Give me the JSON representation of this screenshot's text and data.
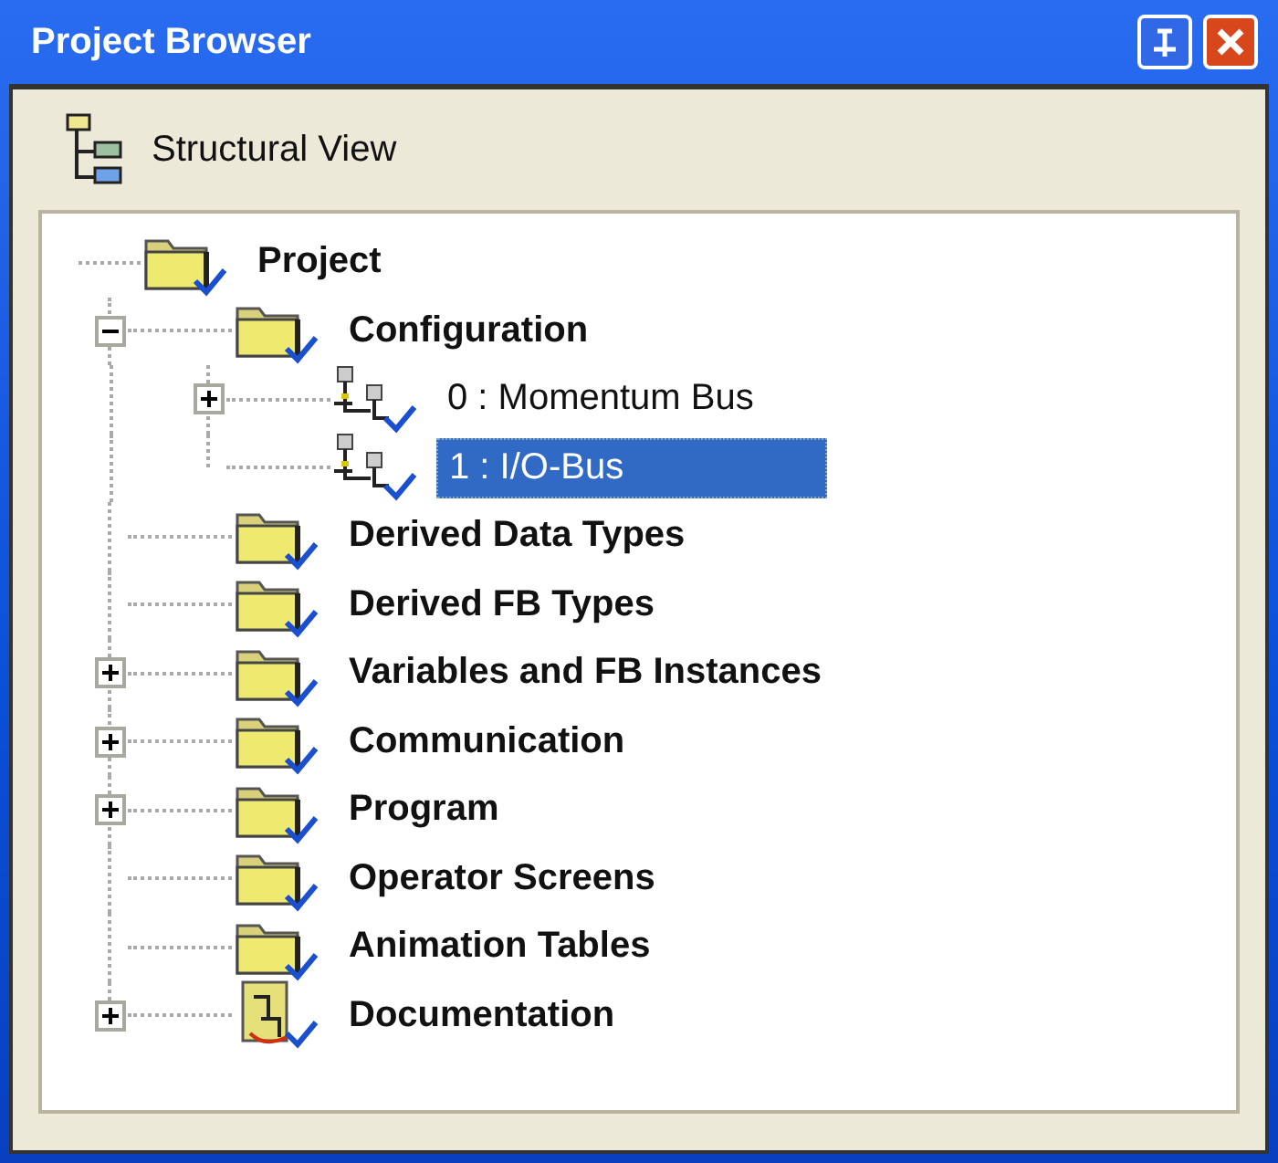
{
  "window": {
    "title": "Project Browser"
  },
  "view": {
    "label": "Structural View"
  },
  "tree": [
    {
      "label": "Project",
      "kind": "folder",
      "selected": false,
      "children": [
        {
          "label": "Configuration",
          "kind": "folder",
          "selected": false,
          "expanded": true,
          "children": [
            {
              "label": "0 : Momentum Bus",
              "kind": "bus",
              "selected": false,
              "expanded": false,
              "bold": false
            },
            {
              "label": "1 : I/O-Bus",
              "kind": "bus",
              "selected": true,
              "bold": false
            }
          ]
        },
        {
          "label": "Derived Data Types",
          "kind": "folder",
          "selected": false
        },
        {
          "label": "Derived FB Types",
          "kind": "folder",
          "selected": false
        },
        {
          "label": "Variables and FB Instances",
          "kind": "folder",
          "selected": false,
          "expanded": false
        },
        {
          "label": "Communication",
          "kind": "folder",
          "selected": false,
          "expanded": false
        },
        {
          "label": "Program",
          "kind": "folder",
          "selected": false,
          "expanded": false
        },
        {
          "label": "Operator Screens",
          "kind": "folder",
          "selected": false
        },
        {
          "label": "Animation Tables",
          "kind": "folder",
          "selected": false
        },
        {
          "label": "Documentation",
          "kind": "documentation",
          "selected": false,
          "expanded": false
        }
      ]
    }
  ]
}
